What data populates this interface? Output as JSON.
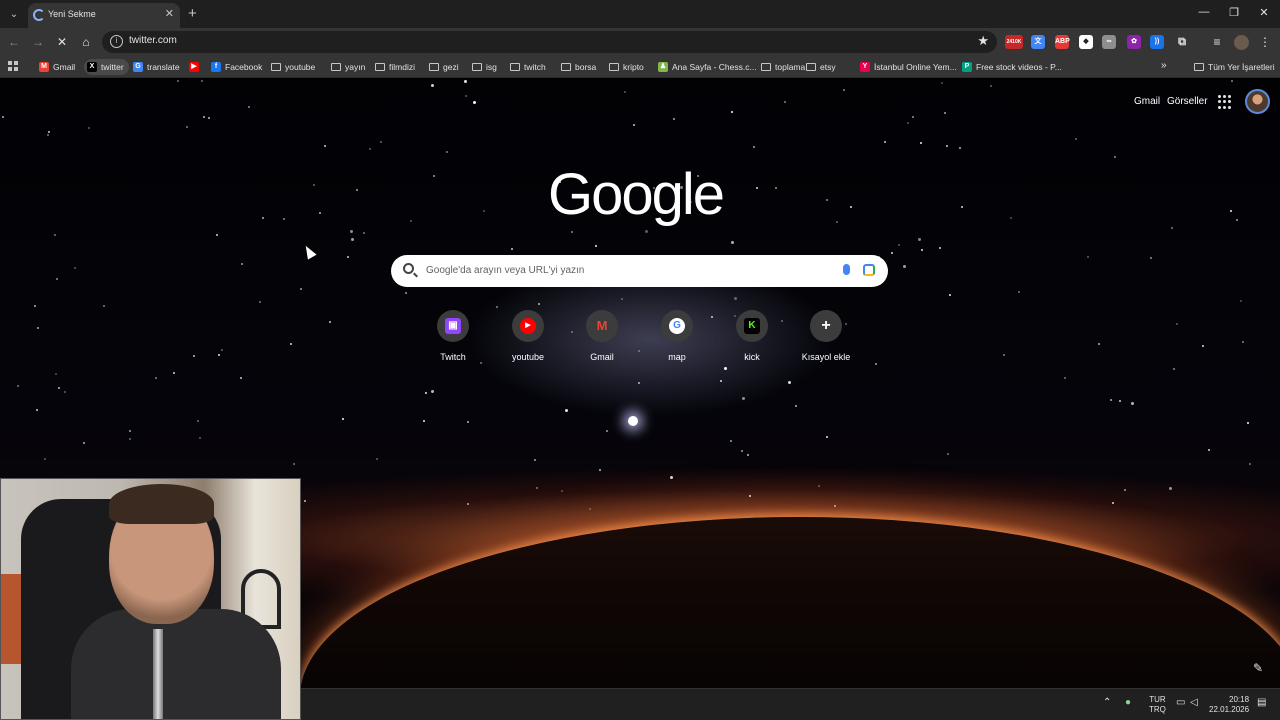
{
  "browser": {
    "tab_title": "Yeni Sekme",
    "new_tab_symbol": "+",
    "url": "twitter.com",
    "window_controls": [
      "—",
      "❐",
      "✕"
    ]
  },
  "bookmarks": [
    {
      "label": "Gmail",
      "kind": "site",
      "icon": "gmail-icon",
      "color": "#ea4335",
      "glyph": "M"
    },
    {
      "label": "twitter",
      "kind": "site",
      "icon": "x-icon",
      "color": "#000000",
      "glyph": "X"
    },
    {
      "label": "translate",
      "kind": "site",
      "icon": "translate-icon",
      "color": "#4285f4",
      "glyph": "G"
    },
    {
      "label": "",
      "kind": "site",
      "icon": "youtube-icon",
      "color": "#ff0000",
      "glyph": "▶"
    },
    {
      "label": "Facebook",
      "kind": "site",
      "icon": "facebook-icon",
      "color": "#1877f2",
      "glyph": "f"
    },
    {
      "label": "youtube",
      "kind": "folder"
    },
    {
      "label": "yayın",
      "kind": "folder"
    },
    {
      "label": "filmdizi",
      "kind": "folder"
    },
    {
      "label": "gezi",
      "kind": "folder"
    },
    {
      "label": "isg",
      "kind": "folder"
    },
    {
      "label": "twitch",
      "kind": "folder"
    },
    {
      "label": "borsa",
      "kind": "folder"
    },
    {
      "label": "kripto",
      "kind": "folder"
    },
    {
      "label": "Ana Sayfa - Chess.c...",
      "kind": "site",
      "icon": "chess-icon",
      "color": "#81b64c",
      "glyph": "♟"
    },
    {
      "label": "toplama",
      "kind": "folder"
    },
    {
      "label": "etsy",
      "kind": "folder"
    },
    {
      "label": "İstanbul Online Yem...",
      "kind": "site",
      "icon": "yemeksepeti-icon",
      "color": "#ea004b",
      "glyph": "Y"
    },
    {
      "label": "Free stock videos - P...",
      "kind": "site",
      "icon": "pexels-icon",
      "color": "#05a081",
      "glyph": "P"
    }
  ],
  "all_bookmarks": "Tüm Yer İşaretleri",
  "extensions": [
    {
      "icon": "extension-badge-icon",
      "color": "#c62828",
      "glyph": "2410K"
    },
    {
      "icon": "translate-ext-icon",
      "color": "#4285f4",
      "glyph": "文"
    },
    {
      "icon": "abp-icon",
      "color": "#e53935",
      "glyph": "ABP"
    },
    {
      "icon": "diamond-ext-icon",
      "color": "#ffffff",
      "glyph": "◆"
    },
    {
      "icon": "glasses-ext-icon",
      "color": "#8e8e8e",
      "glyph": "∞"
    },
    {
      "icon": "purple-ext-icon",
      "color": "#8e24aa",
      "glyph": "✿"
    },
    {
      "icon": "wave-ext-icon",
      "color": "#1a73e8",
      "glyph": "))"
    },
    {
      "icon": "puzzle-icon",
      "color": "#353535",
      "glyph": "⧉"
    }
  ],
  "ntp": {
    "links": {
      "gmail": "Gmail",
      "images": "Görseller"
    },
    "logo": "Google",
    "search_placeholder": "Google'da arayın veya URL'yi yazın",
    "shortcuts": [
      {
        "label": "Twitch",
        "icon": "twitch-icon",
        "color": "#9146ff",
        "glyph": "▣"
      },
      {
        "label": "youtube",
        "icon": "youtube-icon",
        "color": "#ff0000",
        "glyph": "▶"
      },
      {
        "label": "Gmail",
        "icon": "gmail-icon",
        "color": "#ea4335",
        "glyph": "M"
      },
      {
        "label": "map",
        "icon": "google-g-icon",
        "color": "#ffffff",
        "glyph": "G"
      },
      {
        "label": "kick",
        "icon": "kick-icon",
        "color": "#53fc18",
        "glyph": "K"
      },
      {
        "label": "Kısayol ekle",
        "icon": "add-shortcut-icon",
        "color": "#3c3c3c",
        "glyph": "+"
      }
    ]
  },
  "taskbar": {
    "lang_top": "TUR",
    "lang_bottom": "TRQ",
    "time": "20:18",
    "date": "22.01.2026"
  }
}
